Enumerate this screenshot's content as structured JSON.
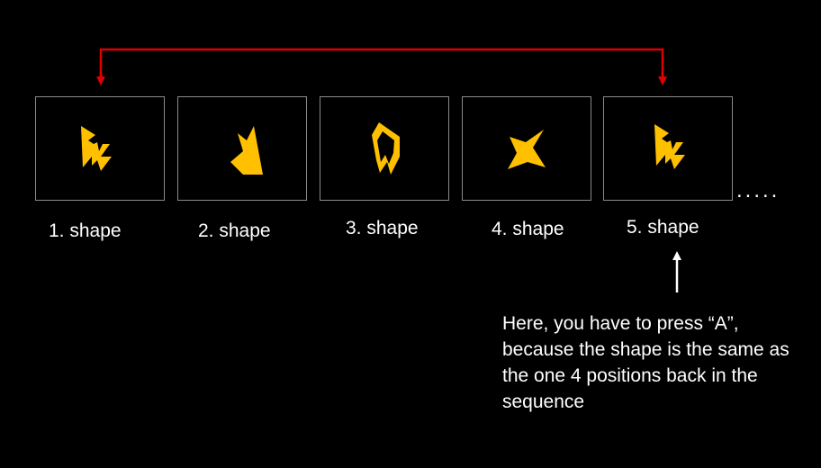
{
  "colors": {
    "background": "#000000",
    "shape_fill": "#ffc000",
    "frame_border": "#8a8a8a",
    "bracket": "#e00000",
    "text": "#ffffff",
    "pointer": "#ffffff"
  },
  "frames": [
    {
      "caption": "1. shape",
      "shape_icon": "shape-zigzag-icon"
    },
    {
      "caption": "2. shape",
      "shape_icon": "shape-wedge-icon"
    },
    {
      "caption": "3. shape",
      "shape_icon": "shape-notched-polygon-icon"
    },
    {
      "caption": "4. shape",
      "shape_icon": "shape-bowtie-icon"
    },
    {
      "caption": "5. shape",
      "shape_icon": "shape-zigzag-icon"
    }
  ],
  "continuation": ".....",
  "explanation": "Here, you have to press “A”, because the shape is the same as the one 4 positions back in the sequence"
}
